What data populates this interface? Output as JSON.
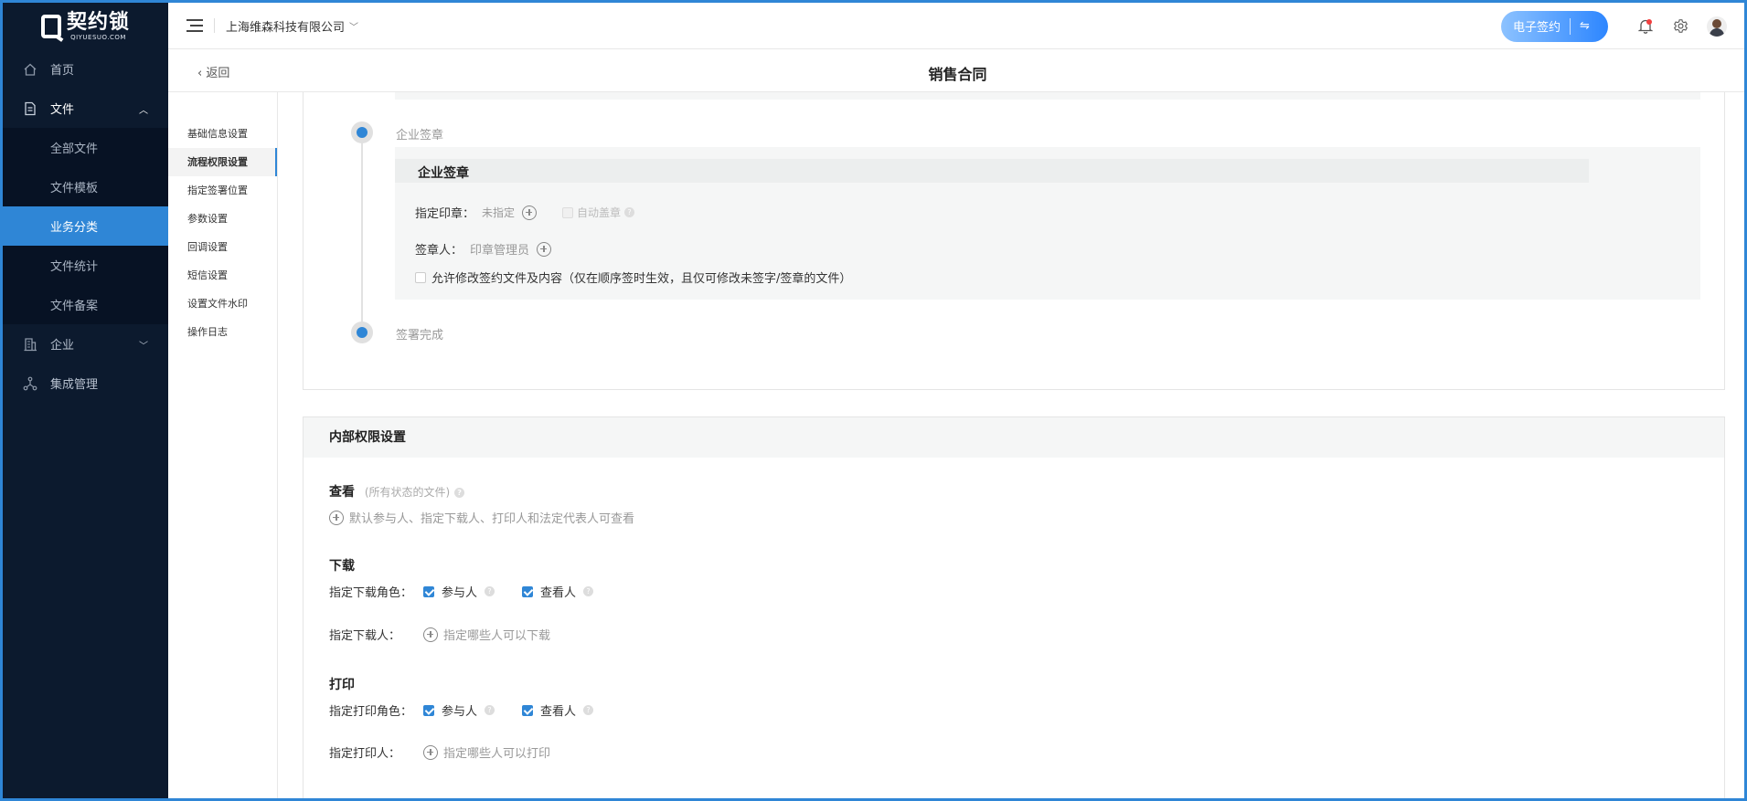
{
  "brand": {
    "name": "契约锁",
    "sub": "QIYUESUO.COM"
  },
  "sidebar": {
    "items": [
      {
        "label": "首页",
        "icon": "home-icon"
      },
      {
        "label": "文件",
        "icon": "file-icon",
        "open": true
      },
      {
        "label": "企业",
        "icon": "building-icon"
      },
      {
        "label": "集成管理",
        "icon": "integration-icon"
      }
    ],
    "file_sub": [
      "全部文件",
      "文件模板",
      "业务分类",
      "文件统计",
      "文件备案"
    ],
    "active_sub": "业务分类"
  },
  "header": {
    "company": "上海维森科技有限公司",
    "esign_label": "电子签约",
    "switch_glyph": "⇋"
  },
  "subheader": {
    "back": "返回",
    "title": "销售合同"
  },
  "inner_nav": [
    "基础信息设置",
    "流程权限设置",
    "指定签署位置",
    "参数设置",
    "回调设置",
    "短信设置",
    "设置文件水印",
    "操作日志"
  ],
  "inner_nav_active": "流程权限设置",
  "flow": {
    "node1_label": "企业签章",
    "seal_title": "企业签章",
    "seal_label": "指定印章：",
    "seal_value": "未指定",
    "auto_seal": "自动盖章",
    "signer_label": "签章人：",
    "signer_value": "印章管理员",
    "allow_modify": "允许修改签约文件及内容（仅在顺序签时生效，且仅可修改未签字/签章的文件）",
    "node2_label": "签署完成"
  },
  "perm": {
    "title": "内部权限设置",
    "view_title": "查看",
    "view_note": "(所有状态的文件)",
    "view_default": "默认参与人、指定下载人、打印人和法定代表人可查看",
    "download_title": "下载",
    "download_role_label": "指定下载角色：",
    "download_person_label": "指定下载人：",
    "download_person_hint": "指定哪些人可以下载",
    "print_title": "打印",
    "print_role_label": "指定打印角色：",
    "print_person_label": "指定打印人：",
    "print_person_hint": "指定哪些人可以打印",
    "role_participant": "参与人",
    "role_viewer": "查看人"
  }
}
